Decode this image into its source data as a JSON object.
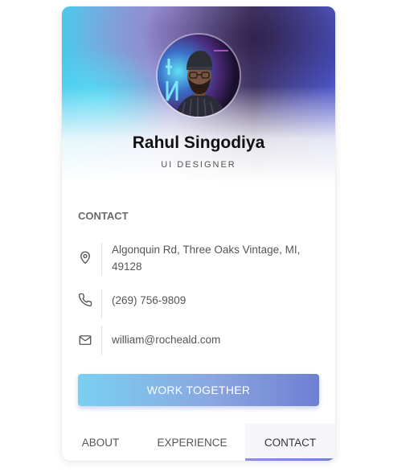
{
  "profile": {
    "name": "Rahul Singodiya",
    "role": "UI DESIGNER",
    "avatar_icon": "profile-photo"
  },
  "contact": {
    "section_title": "CONTACT",
    "address_line1": "Algonquin Rd, Three Oaks Vintage, MI,",
    "address_line2": "49128",
    "phone": "(269) 756-9809",
    "email": "william@rocheald.com",
    "icons": [
      "location-pin-icon",
      "phone-icon",
      "mail-icon"
    ]
  },
  "cta": {
    "label": "WORK TOGETHER"
  },
  "tabs": [
    {
      "label": "ABOUT",
      "active": false
    },
    {
      "label": "EXPERIENCE",
      "active": false
    },
    {
      "label": "CONTACT",
      "active": true
    }
  ],
  "colors": {
    "accent_start": "#79d0f2",
    "accent_end": "#6f7fd4",
    "text_primary": "#111111",
    "text_secondary": "#555555"
  }
}
